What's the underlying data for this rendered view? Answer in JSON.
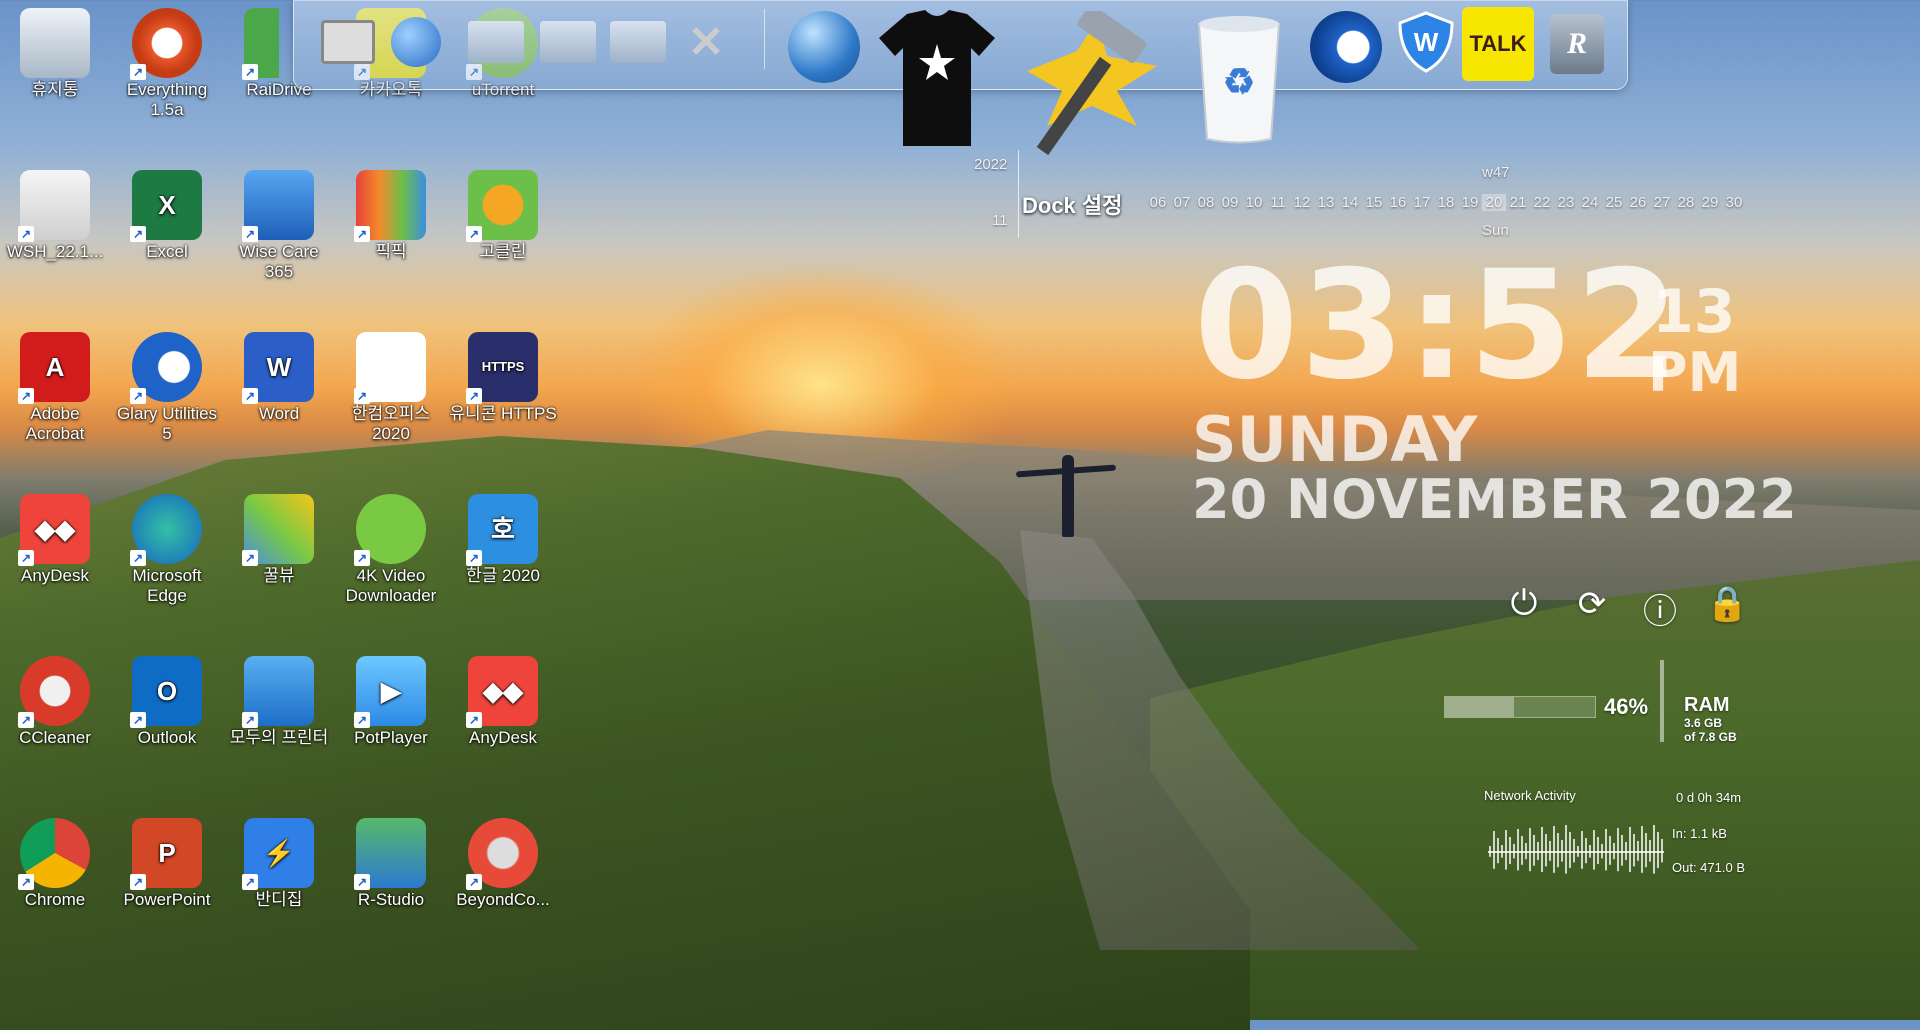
{
  "desktop_icons": [
    {
      "label": "휴지통",
      "icon": "recycle-bin-icon"
    },
    {
      "label": "Everything 1.5a",
      "icon": "everything-search-icon"
    },
    {
      "label": "RaiDrive",
      "icon": "raidrive-icon"
    },
    {
      "label": "카카오톡",
      "icon": "kakaotalk-icon"
    },
    {
      "label": "uTorrent",
      "icon": "utorrent-icon"
    },
    {
      "label": "WSH_22.1...",
      "icon": "disc-image-icon"
    },
    {
      "label": "Excel",
      "icon": "excel-icon"
    },
    {
      "label": "Wise Care 365",
      "icon": "wise-care-icon"
    },
    {
      "label": "픽픽",
      "icon": "picpick-icon"
    },
    {
      "label": "고클린",
      "icon": "goclean-icon"
    },
    {
      "label": "Adobe Acrobat",
      "icon": "acrobat-icon"
    },
    {
      "label": "Glary Utilities 5",
      "icon": "glary-icon"
    },
    {
      "label": "Word",
      "icon": "word-icon"
    },
    {
      "label": "한컴오피스 2020",
      "icon": "hancom-office-icon"
    },
    {
      "label": "유니콘 HTTPS",
      "icon": "unicorn-https-icon"
    },
    {
      "label": "AnyDesk",
      "icon": "anydesk-icon"
    },
    {
      "label": "Microsoft Edge",
      "icon": "edge-icon"
    },
    {
      "label": "꿀뷰",
      "icon": "honeyview-icon"
    },
    {
      "label": "4K Video Downloader",
      "icon": "4k-video-downloader-icon"
    },
    {
      "label": "한글 2020",
      "icon": "hangul-icon"
    },
    {
      "label": "CCleaner",
      "icon": "ccleaner-icon"
    },
    {
      "label": "Outlook",
      "icon": "outlook-icon"
    },
    {
      "label": "모두의 프린터",
      "icon": "printer-icon"
    },
    {
      "label": "PotPlayer",
      "icon": "potplayer-icon"
    },
    {
      "label": "AnyDesk",
      "icon": "anydesk-icon"
    },
    {
      "label": "Chrome",
      "icon": "chrome-icon"
    },
    {
      "label": "PowerPoint",
      "icon": "powerpoint-icon"
    },
    {
      "label": "반디집",
      "icon": "bandizip-icon"
    },
    {
      "label": "R-Studio",
      "icon": "r-studio-icon"
    },
    {
      "label": "BeyondCo...",
      "icon": "beyond-compare-icon"
    }
  ],
  "dock": {
    "tooltip": "Dock 설정",
    "kakao_label": "TALK",
    "items": [
      "computer-icon",
      "network-icon",
      "folder-icon",
      "folder-icon",
      "folder-icon",
      "tools-icon",
      "globe-icon",
      "tshirt-icon",
      "hammer-icon",
      "recycle-bin-icon",
      "glary-icon",
      "wise-care-icon",
      "kakaotalk-icon",
      "r-studio-icon"
    ]
  },
  "calendar": {
    "year": "2022",
    "month": "11",
    "week": "w47",
    "days": [
      "06",
      "07",
      "08",
      "09",
      "10",
      "11",
      "12",
      "13",
      "14",
      "15",
      "16",
      "17",
      "18",
      "19",
      "20",
      "21",
      "22",
      "23",
      "24",
      "25",
      "26",
      "27",
      "28",
      "29",
      "30"
    ],
    "today": "20",
    "today_name": "Sun"
  },
  "clock": {
    "time": "03:52",
    "seconds": "13",
    "ampm": "PM",
    "weekday": "SUNDAY",
    "date": "20 NOVEMBER 2022"
  },
  "system_buttons": [
    "power-icon",
    "restart-icon",
    "sleep-icon",
    "lock-icon"
  ],
  "ram": {
    "label": "RAM",
    "percent": "46%",
    "percent_value": 0.46,
    "used": "3.6 GB",
    "total": "of 7.8 GB"
  },
  "network": {
    "title": "Network Activity",
    "uptime": "0 d 0h 34m",
    "in": "In: 1.1 kB",
    "out": "Out: 471.0 B"
  }
}
